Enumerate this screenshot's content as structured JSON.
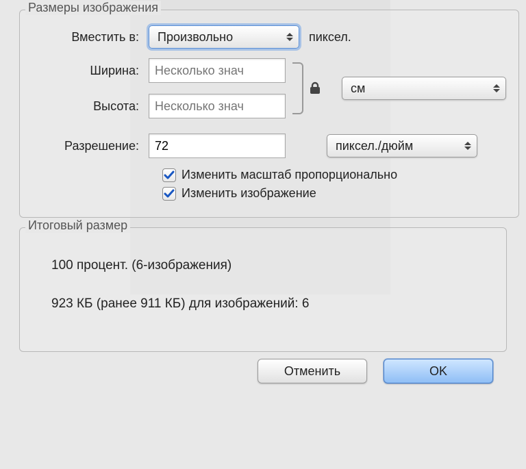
{
  "group1": {
    "title": "Размеры изображения",
    "fit_label": "Вместить в:",
    "fit_value": "Произвольно",
    "fit_suffix": "пиксел.",
    "width_label": "Ширина:",
    "width_placeholder": "Несколько знач",
    "height_label": "Высота:",
    "height_placeholder": "Несколько знач",
    "dim_unit": "см",
    "resolution_label": "Разрешение:",
    "resolution_value": "72",
    "resolution_unit": "пиксел./дюйм",
    "check_scale": "Изменить масштаб пропорционально",
    "check_resample": "Изменить изображение"
  },
  "group2": {
    "title": "Итоговый размер",
    "line1": "100 процент. (6-изображения)",
    "line2": "923 КБ (ранее 911 КБ) для изображений: 6"
  },
  "buttons": {
    "cancel": "Отменить",
    "ok": "OK"
  }
}
